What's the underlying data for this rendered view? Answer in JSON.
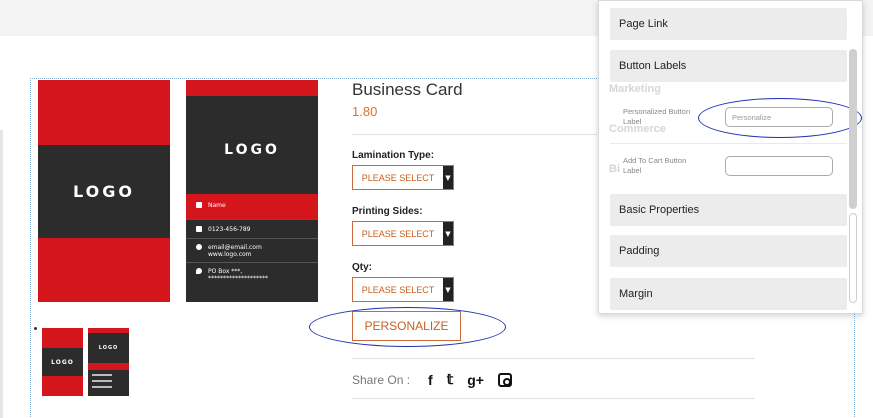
{
  "product": {
    "title": "Business Card",
    "price": "1.80",
    "personalize_label": "PERSONALIZE",
    "options": [
      {
        "label": "Lamination Type:",
        "value": "PLEASE SELECT"
      },
      {
        "label": "Printing Sides:",
        "value": "PLEASE SELECT"
      },
      {
        "label": "Qty:",
        "value": "PLEASE SELECT"
      }
    ],
    "share_label": "Share On :",
    "share_icons": [
      "f",
      "𝕥",
      "g+"
    ]
  },
  "card": {
    "logo": "LOGO",
    "name": "Name",
    "phone": "0123-456-789",
    "email": "email@email.com",
    "web": "www.logo.com",
    "address": "PO Box ***,",
    "address2": "********************"
  },
  "thumbs": {
    "logo": "LOGO"
  },
  "panel": {
    "sections": {
      "page_link": "Page Link",
      "button_labels": "Button Labels",
      "basic_properties": "Basic Properties",
      "padding": "Padding",
      "margin": "Margin"
    },
    "ghost": {
      "marketing": "Marketing",
      "commerce": "Commerce",
      "bi": "Bi"
    },
    "fields": {
      "personalized_label": "Personalized Button Label",
      "personalized_value": "Personalize",
      "add_to_cart_label": "Add To Cart Button Label",
      "add_to_cart_value": ""
    }
  },
  "colors": {
    "brand_red": "#d4151c",
    "dark": "#2c2c2c",
    "accent_orange": "#c9601f",
    "annotation_blue": "#1f2fb5"
  }
}
